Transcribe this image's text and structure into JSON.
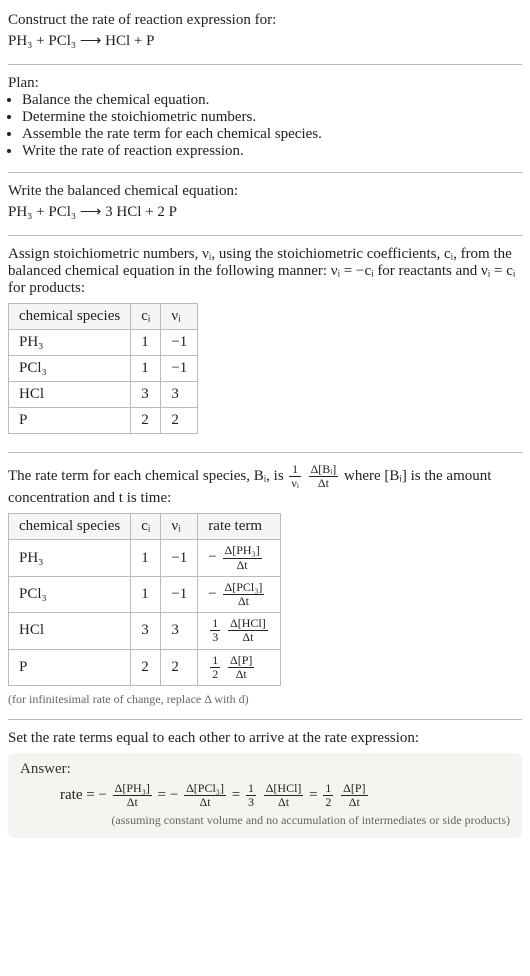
{
  "intro": {
    "title": "Construct the rate of reaction expression for:",
    "unbalanced": "PH₃ + PCl₃ ⟶ HCl + P"
  },
  "plan": {
    "title": "Plan:",
    "items": [
      "Balance the chemical equation.",
      "Determine the stoichiometric numbers.",
      "Assemble the rate term for each chemical species.",
      "Write the rate of reaction expression."
    ]
  },
  "balanced": {
    "title": "Write the balanced chemical equation:",
    "equation": "PH₃ + PCl₃ ⟶ 3 HCl + 2 P"
  },
  "stoich": {
    "intro_a": "Assign stoichiometric numbers, νᵢ, using the stoichiometric coefficients, cᵢ, from the balanced chemical equation in the following manner: νᵢ = −cᵢ for reactants and νᵢ = cᵢ for products:",
    "headers": [
      "chemical species",
      "cᵢ",
      "νᵢ"
    ],
    "rows": [
      {
        "species": "PH₃",
        "c": "1",
        "v": "−1"
      },
      {
        "species": "PCl₃",
        "c": "1",
        "v": "−1"
      },
      {
        "species": "HCl",
        "c": "3",
        "v": "3"
      },
      {
        "species": "P",
        "c": "2",
        "v": "2"
      }
    ]
  },
  "rateterm": {
    "intro_pre": "The rate term for each chemical species, Bᵢ, is ",
    "intro_post": " where [Bᵢ] is the amount concentration and t is time:",
    "headers": [
      "chemical species",
      "cᵢ",
      "νᵢ",
      "rate term"
    ],
    "rows": [
      {
        "species": "PH₃",
        "c": "1",
        "v": "−1",
        "sign": "−",
        "coef": "",
        "dnum": "Δ[PH₃]",
        "dden": "Δt"
      },
      {
        "species": "PCl₃",
        "c": "1",
        "v": "−1",
        "sign": "−",
        "coef": "",
        "dnum": "Δ[PCl₃]",
        "dden": "Δt"
      },
      {
        "species": "HCl",
        "c": "3",
        "v": "3",
        "sign": "",
        "coef": "1/3",
        "dnum": "Δ[HCl]",
        "dden": "Δt"
      },
      {
        "species": "P",
        "c": "2",
        "v": "2",
        "sign": "",
        "coef": "1/2",
        "dnum": "Δ[P]",
        "dden": "Δt"
      }
    ],
    "caption": "(for infinitesimal rate of change, replace Δ with d)"
  },
  "final": {
    "intro": "Set the rate terms equal to each other to arrive at the rate expression:",
    "answer_label": "Answer:",
    "rate_label": "rate = ",
    "note": "(assuming constant volume and no accumulation of intermediates or side products)"
  }
}
